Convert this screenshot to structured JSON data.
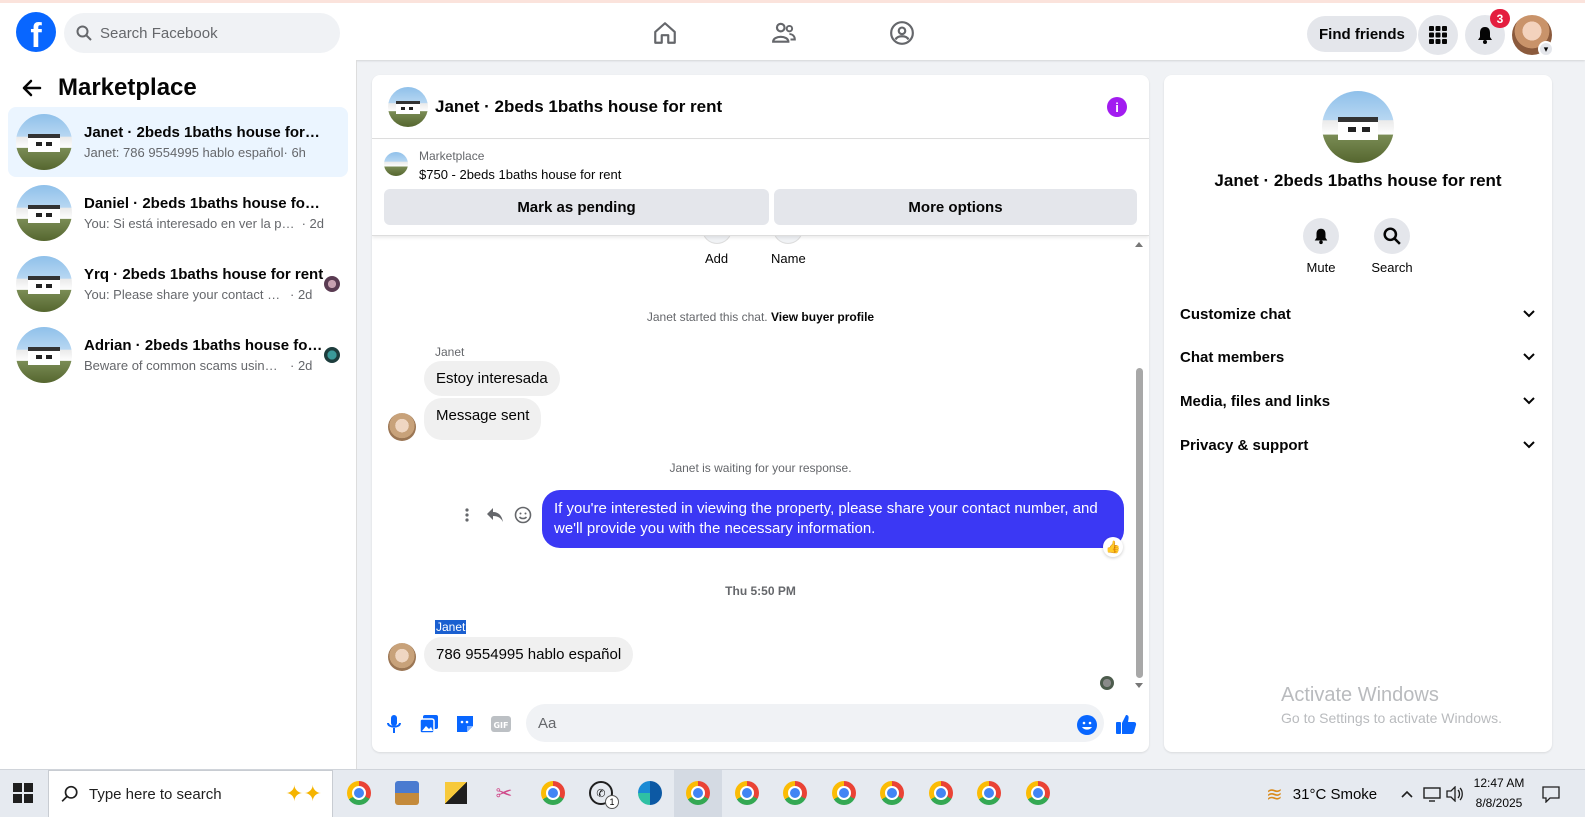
{
  "topbar": {
    "logo": "f",
    "search_placeholder": "Search Facebook",
    "find_friends": "Find friends",
    "notification_count": "3",
    "icons": [
      "home-icon",
      "friends-icon",
      "groups-icon",
      "menu-grid-icon",
      "bell-icon"
    ]
  },
  "left": {
    "title": "Marketplace",
    "conversations": [
      {
        "title": "Janet · 2beds 1baths house for rent",
        "snippet": "Janet: 786 9554995 hablo español",
        "time": "· 6h",
        "active": true
      },
      {
        "title": "Daniel · 2beds 1baths house for rent",
        "snippet": "You: Si está interesado en ver la propi...",
        "time": "· 2d"
      },
      {
        "title": "Yrq · 2beds 1baths house for rent",
        "snippet": "You: Please share your contact nu...",
        "time": "· 2d"
      },
      {
        "title": "Adrian · 2beds 1baths house for ...",
        "snippet": "Beware of common scams using p...",
        "time": "· 2d"
      }
    ]
  },
  "chat": {
    "title": "Janet · 2beds 1baths house for rent",
    "listing": {
      "label": "Marketplace",
      "price_title": "$750 - 2beds 1baths house for rent",
      "mark_pending": "Mark as pending",
      "more_options": "More options"
    },
    "partial_actions": [
      "Add",
      "Name"
    ],
    "started_text": "Janet started this chat.",
    "view_buyer": "View buyer profile",
    "sender": "Janet",
    "msg1": "Estoy interesada",
    "msg2": "Message sent",
    "waiting": "Janet is waiting for your response.",
    "outgoing": "If you're interested in viewing the property, please share your contact number, and we'll provide you with the necessary information.",
    "reaction": "👍",
    "timestamp": "Thu 5:50 PM",
    "sender2": "Janet",
    "msg3": "786 9554995  hablo español",
    "composer_placeholder": "Aa"
  },
  "right": {
    "title": "Janet · 2beds 1baths house for rent",
    "mute": "Mute",
    "search": "Search",
    "rows": [
      "Customize chat",
      "Chat members",
      "Media, files and links",
      "Privacy & support"
    ],
    "watermark_title": "Activate Windows",
    "watermark_sub": "Go to Settings to activate Windows."
  },
  "taskbar": {
    "search_placeholder": "Type here to search",
    "weather": "31°C  Smoke",
    "time": "12:47 AM",
    "date": "8/8/2025",
    "whatsapp_badge": "1"
  },
  "colors": {
    "brand": "#0866ff",
    "outgoing_bubble": "#3b38f4",
    "badge": "#e41e3f",
    "info": "#a21cf0"
  }
}
